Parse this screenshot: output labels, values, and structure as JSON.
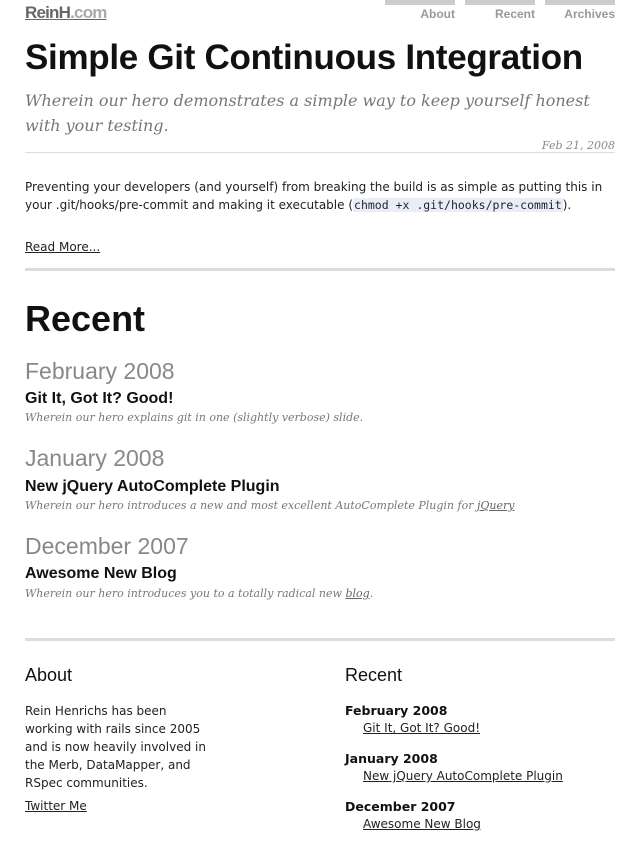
{
  "header": {
    "logo_main": "ReinH",
    "logo_tld": ".com",
    "nav": [
      "About",
      "Recent",
      "Archives"
    ]
  },
  "post": {
    "title": "Simple Git Continuous Integration",
    "subtitle": "Wherein our hero demonstrates a simple way to keep yourself honest with your testing.",
    "date": "Feb 21, 2008",
    "excerpt_before": "Preventing your developers (and yourself) from breaking the build is as simple as putting this in your .git/hooks/pre-commit and making it executable (",
    "excerpt_code": "chmod +x .git/hooks/pre-commit",
    "excerpt_after": ").",
    "read_more": "Read More..."
  },
  "recent": {
    "heading": "Recent",
    "groups": [
      {
        "month": "February 2008",
        "title": "Git It, Got It? Good!",
        "desc": "Wherein our hero explains git in one (slightly verbose) slide."
      },
      {
        "month": "January 2008",
        "title": "New jQuery AutoComplete Plugin",
        "desc": "Wherein our hero introduces a new and most excellent AutoComplete Plugin for ",
        "desc_link": "jQuery"
      },
      {
        "month": "December 2007",
        "title": "Awesome New Blog",
        "desc": "Wherein our hero introduces you to a totally radical new ",
        "desc_link": "blog",
        "desc_after": "."
      }
    ]
  },
  "footer": {
    "about_heading": "About",
    "about_text": "Rein Henrichs has been working with rails since 2005 and is now heavily involved in the Merb, DataMapper, and RSpec communities.",
    "twitter": "Twitter Me",
    "recent_heading": "Recent",
    "recent": [
      {
        "month": "February 2008",
        "link": "Git It, Got It? Good!"
      },
      {
        "month": "January 2008",
        "link": "New jQuery AutoComplete Plugin"
      },
      {
        "month": "December 2007",
        "link": "Awesome New Blog"
      }
    ]
  }
}
